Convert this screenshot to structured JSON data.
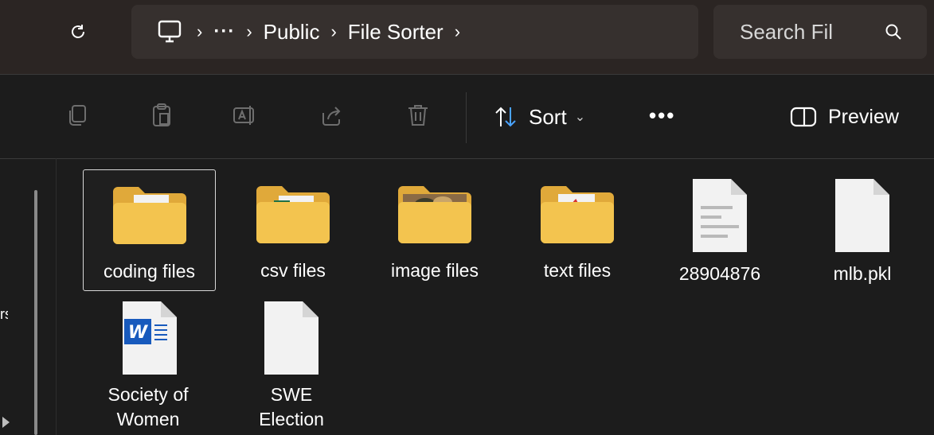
{
  "address_bar": {
    "breadcrumbs": [
      "Public",
      "File Sorter"
    ],
    "overflow_label": "···",
    "search_placeholder": "Search Fil"
  },
  "command_bar": {
    "icons": [
      "copy-icon",
      "paste-icon",
      "rename-icon",
      "share-icon",
      "delete-icon"
    ],
    "sort_label": "Sort",
    "more_label": "•••",
    "preview_label": "Preview"
  },
  "nav": {
    "clipped_label": "rsi"
  },
  "files": [
    {
      "name": "coding files",
      "type": "folder",
      "icon": "folder-document-icon",
      "selected": true
    },
    {
      "name": "csv files",
      "type": "folder",
      "icon": "folder-excel-icon",
      "selected": false
    },
    {
      "name": "image files",
      "type": "folder",
      "icon": "folder-image-icon",
      "selected": false
    },
    {
      "name": "text files",
      "type": "folder",
      "icon": "folder-pdf-icon",
      "selected": false
    },
    {
      "name": "28904876",
      "type": "file",
      "icon": "text-file-icon",
      "selected": false
    },
    {
      "name": "mlb.pkl",
      "type": "file",
      "icon": "blank-file-icon",
      "selected": false
    },
    {
      "name_lines": [
        "Society of",
        "Women"
      ],
      "type": "file",
      "icon": "word-document-icon",
      "selected": false
    },
    {
      "name_lines": [
        "SWE",
        "Election"
      ],
      "type": "file",
      "icon": "blank-file-icon",
      "selected": false
    }
  ],
  "colors": {
    "background": "#1c1c1c",
    "topbar": "#2b2523",
    "field": "#36302e",
    "folder": "#f3c44f",
    "word_blue": "#185abd"
  }
}
